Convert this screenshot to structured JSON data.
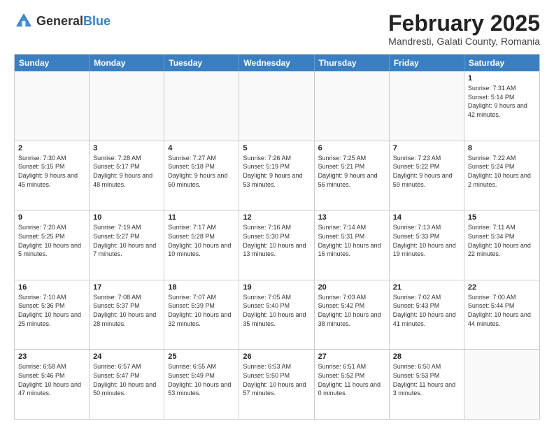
{
  "header": {
    "logo_general": "General",
    "logo_blue": "Blue",
    "title": "February 2025",
    "location": "Mandresti, Galati County, Romania"
  },
  "days_of_week": [
    "Sunday",
    "Monday",
    "Tuesday",
    "Wednesday",
    "Thursday",
    "Friday",
    "Saturday"
  ],
  "weeks": [
    [
      {
        "day": "",
        "text": ""
      },
      {
        "day": "",
        "text": ""
      },
      {
        "day": "",
        "text": ""
      },
      {
        "day": "",
        "text": ""
      },
      {
        "day": "",
        "text": ""
      },
      {
        "day": "",
        "text": ""
      },
      {
        "day": "1",
        "text": "Sunrise: 7:31 AM\nSunset: 5:14 PM\nDaylight: 9 hours and 42 minutes."
      }
    ],
    [
      {
        "day": "2",
        "text": "Sunrise: 7:30 AM\nSunset: 5:15 PM\nDaylight: 9 hours and 45 minutes."
      },
      {
        "day": "3",
        "text": "Sunrise: 7:28 AM\nSunset: 5:17 PM\nDaylight: 9 hours and 48 minutes."
      },
      {
        "day": "4",
        "text": "Sunrise: 7:27 AM\nSunset: 5:18 PM\nDaylight: 9 hours and 50 minutes."
      },
      {
        "day": "5",
        "text": "Sunrise: 7:26 AM\nSunset: 5:19 PM\nDaylight: 9 hours and 53 minutes."
      },
      {
        "day": "6",
        "text": "Sunrise: 7:25 AM\nSunset: 5:21 PM\nDaylight: 9 hours and 56 minutes."
      },
      {
        "day": "7",
        "text": "Sunrise: 7:23 AM\nSunset: 5:22 PM\nDaylight: 9 hours and 59 minutes."
      },
      {
        "day": "8",
        "text": "Sunrise: 7:22 AM\nSunset: 5:24 PM\nDaylight: 10 hours and 2 minutes."
      }
    ],
    [
      {
        "day": "9",
        "text": "Sunrise: 7:20 AM\nSunset: 5:25 PM\nDaylight: 10 hours and 5 minutes."
      },
      {
        "day": "10",
        "text": "Sunrise: 7:19 AM\nSunset: 5:27 PM\nDaylight: 10 hours and 7 minutes."
      },
      {
        "day": "11",
        "text": "Sunrise: 7:17 AM\nSunset: 5:28 PM\nDaylight: 10 hours and 10 minutes."
      },
      {
        "day": "12",
        "text": "Sunrise: 7:16 AM\nSunset: 5:30 PM\nDaylight: 10 hours and 13 minutes."
      },
      {
        "day": "13",
        "text": "Sunrise: 7:14 AM\nSunset: 5:31 PM\nDaylight: 10 hours and 16 minutes."
      },
      {
        "day": "14",
        "text": "Sunrise: 7:13 AM\nSunset: 5:33 PM\nDaylight: 10 hours and 19 minutes."
      },
      {
        "day": "15",
        "text": "Sunrise: 7:11 AM\nSunset: 5:34 PM\nDaylight: 10 hours and 22 minutes."
      }
    ],
    [
      {
        "day": "16",
        "text": "Sunrise: 7:10 AM\nSunset: 5:36 PM\nDaylight: 10 hours and 25 minutes."
      },
      {
        "day": "17",
        "text": "Sunrise: 7:08 AM\nSunset: 5:37 PM\nDaylight: 10 hours and 28 minutes."
      },
      {
        "day": "18",
        "text": "Sunrise: 7:07 AM\nSunset: 5:39 PM\nDaylight: 10 hours and 32 minutes."
      },
      {
        "day": "19",
        "text": "Sunrise: 7:05 AM\nSunset: 5:40 PM\nDaylight: 10 hours and 35 minutes."
      },
      {
        "day": "20",
        "text": "Sunrise: 7:03 AM\nSunset: 5:42 PM\nDaylight: 10 hours and 38 minutes."
      },
      {
        "day": "21",
        "text": "Sunrise: 7:02 AM\nSunset: 5:43 PM\nDaylight: 10 hours and 41 minutes."
      },
      {
        "day": "22",
        "text": "Sunrise: 7:00 AM\nSunset: 5:44 PM\nDaylight: 10 hours and 44 minutes."
      }
    ],
    [
      {
        "day": "23",
        "text": "Sunrise: 6:58 AM\nSunset: 5:46 PM\nDaylight: 10 hours and 47 minutes."
      },
      {
        "day": "24",
        "text": "Sunrise: 6:57 AM\nSunset: 5:47 PM\nDaylight: 10 hours and 50 minutes."
      },
      {
        "day": "25",
        "text": "Sunrise: 6:55 AM\nSunset: 5:49 PM\nDaylight: 10 hours and 53 minutes."
      },
      {
        "day": "26",
        "text": "Sunrise: 6:53 AM\nSunset: 5:50 PM\nDaylight: 10 hours and 57 minutes."
      },
      {
        "day": "27",
        "text": "Sunrise: 6:51 AM\nSunset: 5:52 PM\nDaylight: 11 hours and 0 minutes."
      },
      {
        "day": "28",
        "text": "Sunrise: 6:50 AM\nSunset: 5:53 PM\nDaylight: 11 hours and 3 minutes."
      },
      {
        "day": "",
        "text": ""
      }
    ]
  ]
}
